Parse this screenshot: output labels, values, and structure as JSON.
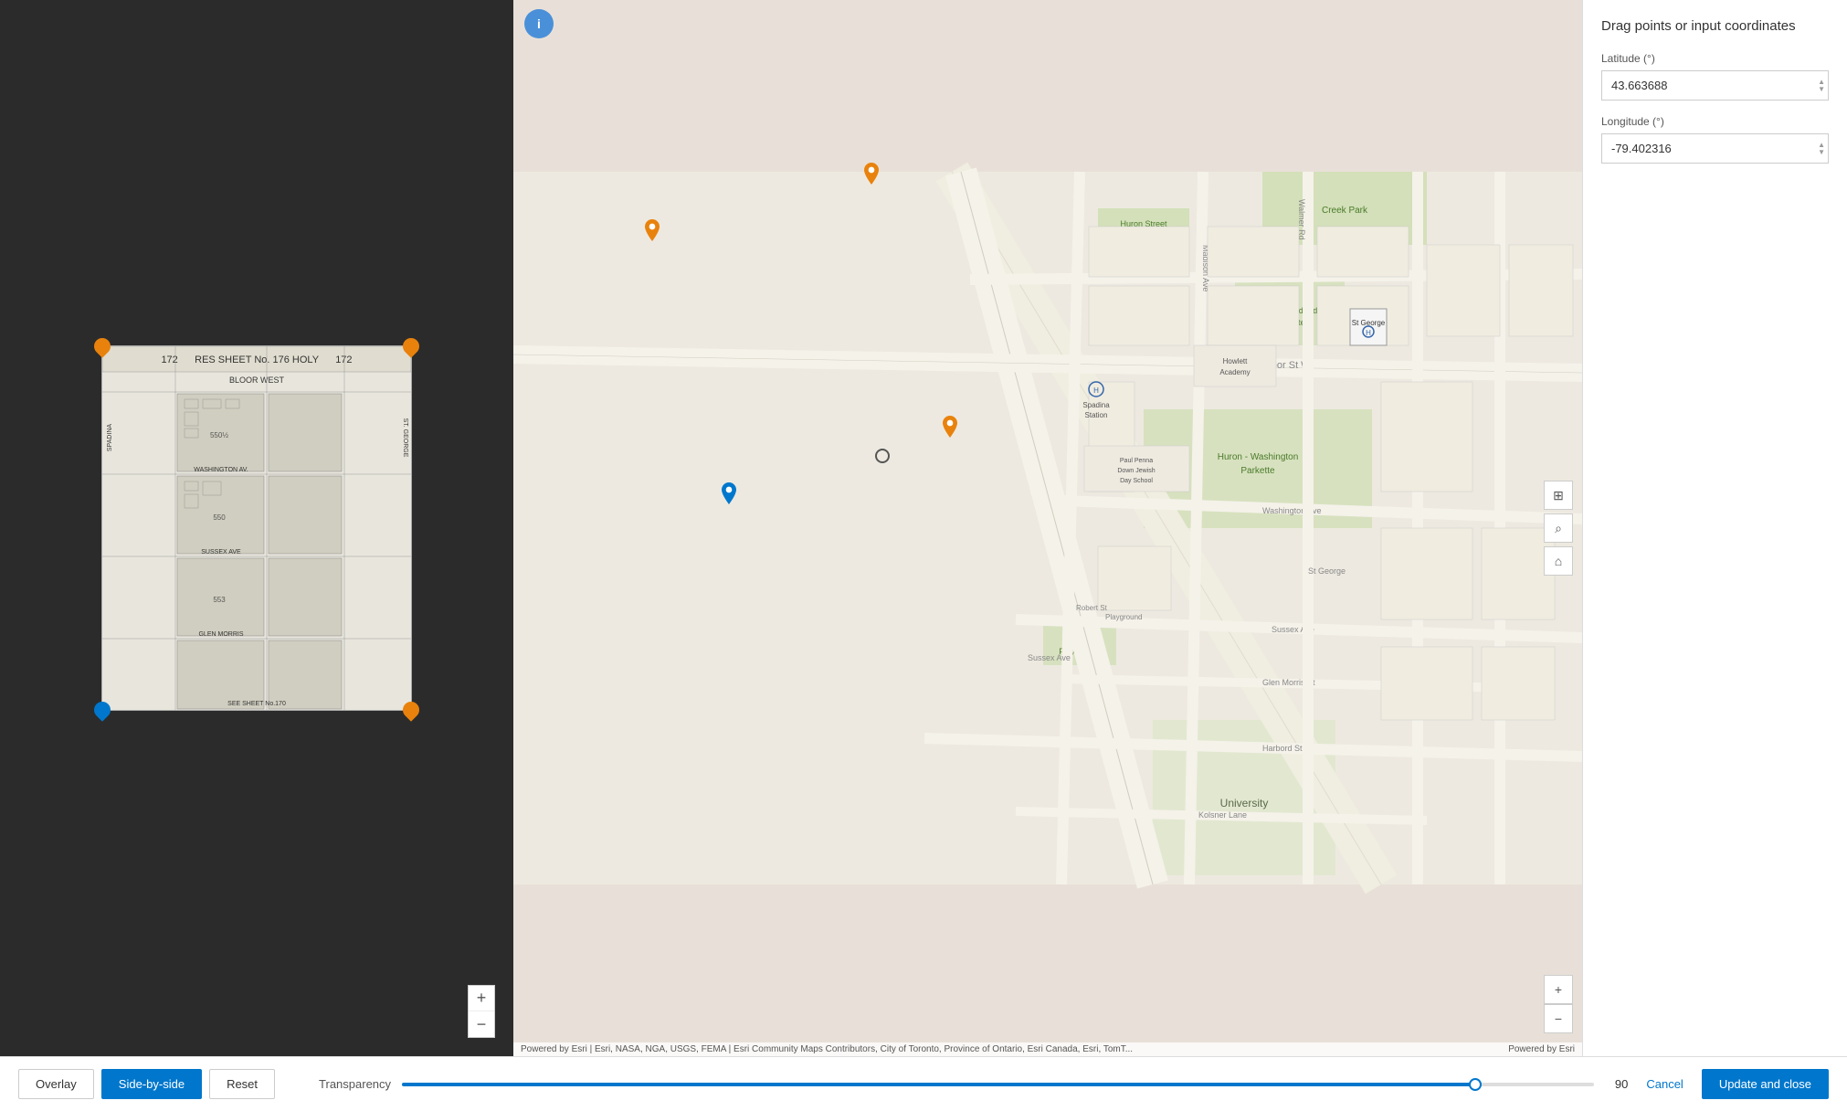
{
  "header": {
    "title": "Drag points or input coordinates"
  },
  "coords": {
    "latitude_label": "Latitude (°)",
    "longitude_label": "Longitude (°)",
    "latitude_value": "43.663688",
    "longitude_value": "-79.402316"
  },
  "bottom_bar": {
    "overlay_label": "Overlay",
    "side_by_side_label": "Side-by-side",
    "reset_label": "Reset",
    "transparency_label": "Transparency",
    "transparency_value": "90",
    "cancel_label": "Cancel",
    "update_close_label": "Update and close",
    "slider_percent": 90
  },
  "map": {
    "attribution_left": "Powered by Esri | Esri, NASA, NGA, USGS, FEMA | Esri Community Maps Contributors, City of Toronto, Province of Ontario, Esri Canada, Esri, TomT...",
    "attribution_right": "Powered by Esri"
  },
  "icons": {
    "zoom_in": "+",
    "zoom_out": "−",
    "info": "i",
    "grid": "⊞",
    "search": "⌕",
    "home": "⌂",
    "up_arrow": "▲",
    "down_arrow": "▼"
  }
}
